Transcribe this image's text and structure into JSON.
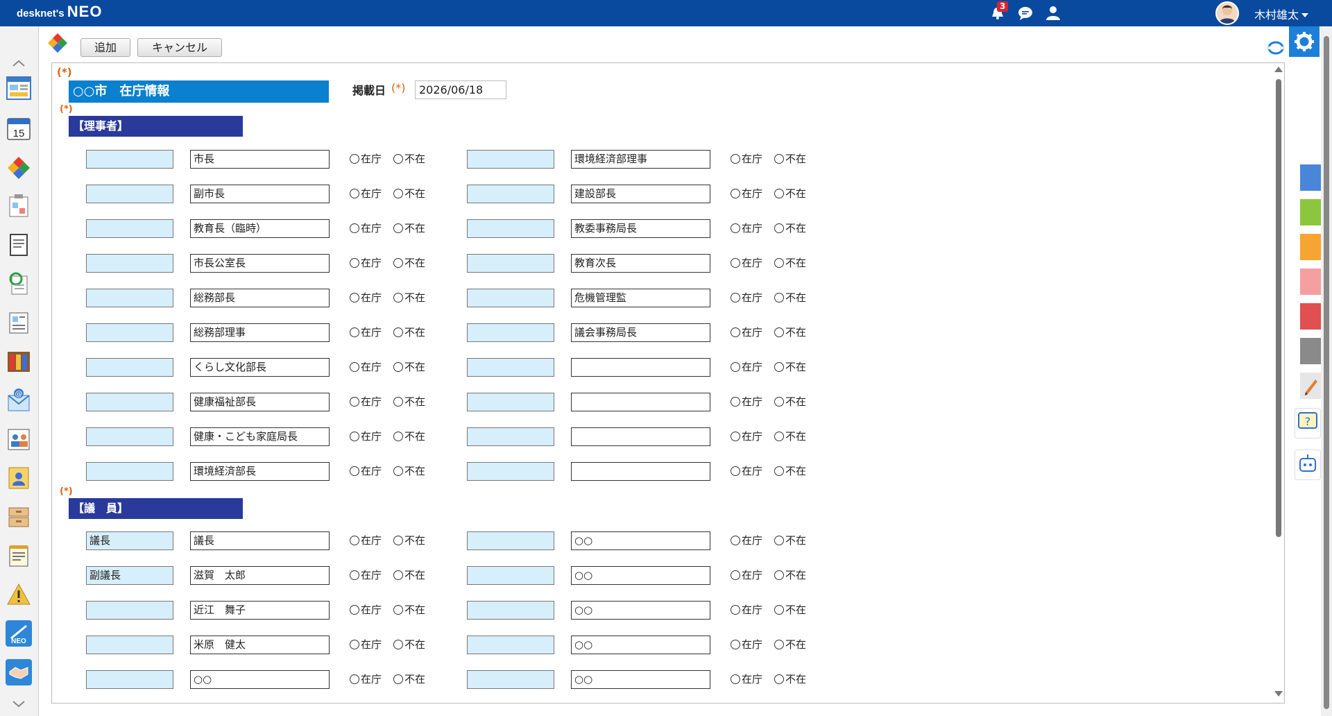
{
  "app": {
    "logo_brand": "desknet's",
    "logo_product": "NEO",
    "notification_count": "3",
    "user_name": "木村雄太"
  },
  "toolbar": {
    "add_label": "追加",
    "cancel_label": "キャンセル"
  },
  "form": {
    "required_mark": "(*)",
    "title": "○○市　在庁情報",
    "date_label": "掲載日",
    "date_required": "(*)",
    "date_value": "2026/06/18",
    "section1_title": "【理事者】",
    "section2_title": "【議　員】",
    "radio_in": "在庁",
    "radio_out": "不在"
  },
  "section1_rows": [
    {
      "l1": "",
      "l2": "市長",
      "r1": "",
      "r2": "環境経済部理事"
    },
    {
      "l1": "",
      "l2": "副市長",
      "r1": "",
      "r2": "建設部長"
    },
    {
      "l1": "",
      "l2": "教育長（臨時）",
      "r1": "",
      "r2": "教委事務局長"
    },
    {
      "l1": "",
      "l2": "市長公室長",
      "r1": "",
      "r2": "教育次長"
    },
    {
      "l1": "",
      "l2": "総務部長",
      "r1": "",
      "r2": "危機管理監"
    },
    {
      "l1": "",
      "l2": "総務部理事",
      "r1": "",
      "r2": "議会事務局長"
    },
    {
      "l1": "",
      "l2": "くらし文化部長",
      "r1": "",
      "r2": ""
    },
    {
      "l1": "",
      "l2": "健康福祉部長",
      "r1": "",
      "r2": ""
    },
    {
      "l1": "",
      "l2": "健康・こども家庭局長",
      "r1": "",
      "r2": ""
    },
    {
      "l1": "",
      "l2": "環境経済部長",
      "r1": "",
      "r2": ""
    }
  ],
  "section2_rows": [
    {
      "l1": "議長",
      "l2": "議長",
      "r1": "",
      "r2": "○○"
    },
    {
      "l1": "副議長",
      "l2": "滋賀　太郎",
      "r1": "",
      "r2": "○○"
    },
    {
      "l1": "",
      "l2": "近江　舞子",
      "r1": "",
      "r2": "○○"
    },
    {
      "l1": "",
      "l2": "米原　健太",
      "r1": "",
      "r2": "○○"
    },
    {
      "l1": "",
      "l2": "○○",
      "r1": "",
      "r2": "○○"
    }
  ]
}
